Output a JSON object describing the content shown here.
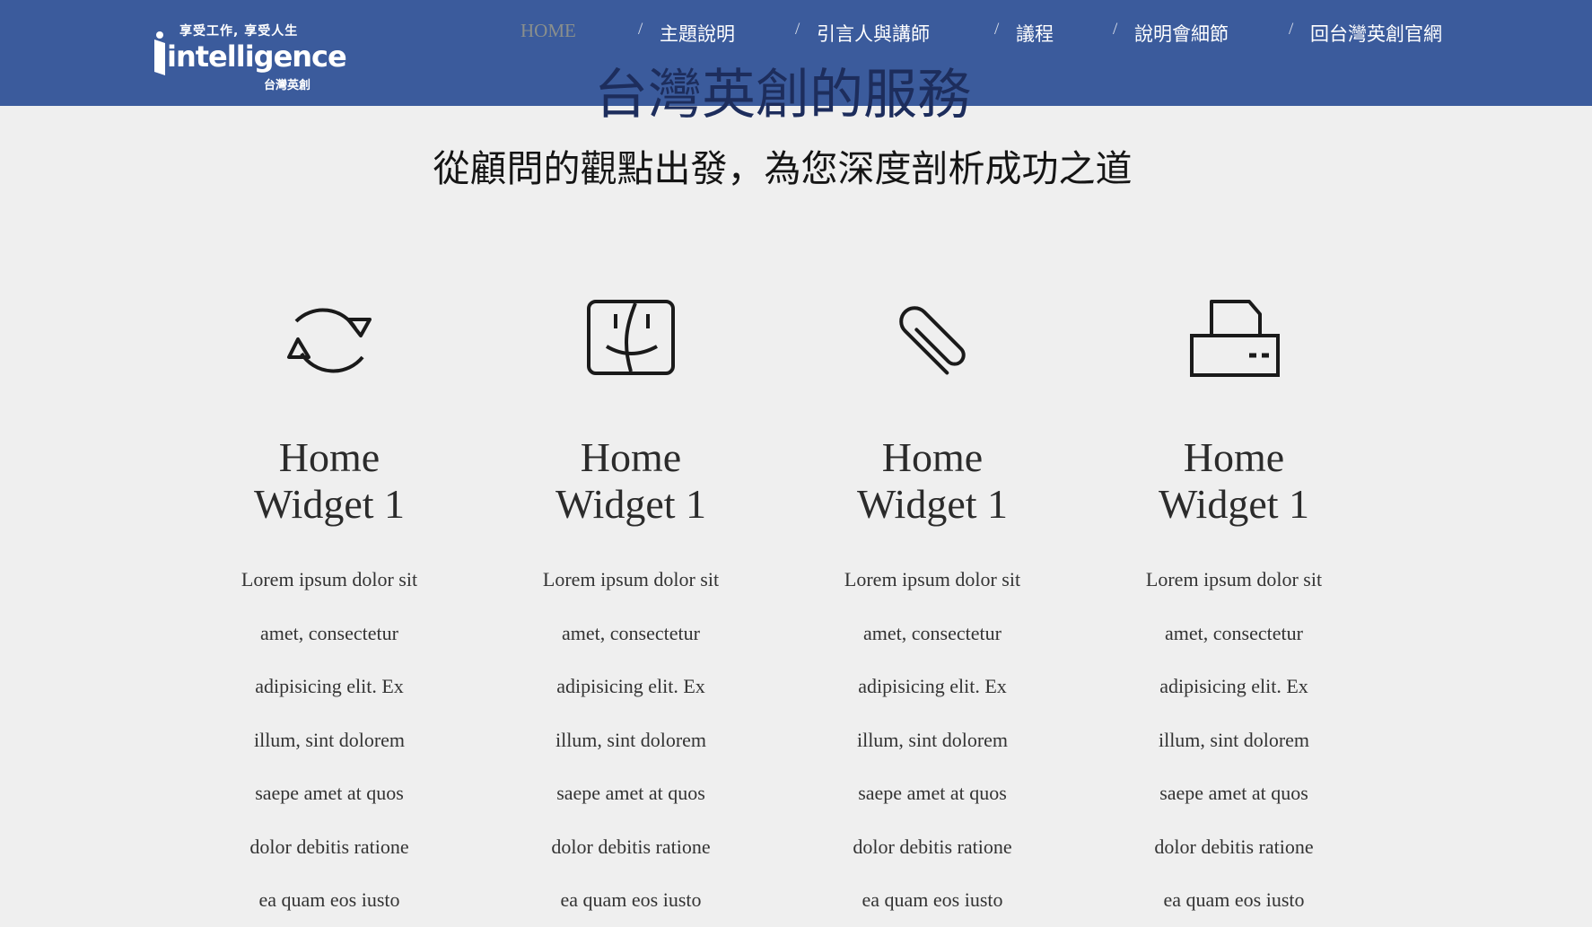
{
  "colors": {
    "navbar_bg": "#3b5b9c",
    "page_bg": "#efefef",
    "hero_title": "#1d2d5c",
    "nav_active": "#8a8f8c",
    "nav_text": "#ffffff"
  },
  "logo": {
    "tagline": "享受工作, 享受人生",
    "wordmark": "intelligence",
    "sub": "台灣英創"
  },
  "nav": {
    "items": [
      {
        "label": "HOME",
        "active": true
      },
      {
        "label": "主題說明",
        "active": false
      },
      {
        "label": "引言人與講師",
        "active": false
      },
      {
        "label": "議程",
        "active": false
      },
      {
        "label": "說明會細節",
        "active": false
      },
      {
        "label": "回台灣英創官網",
        "active": false
      }
    ],
    "separator": "/"
  },
  "hero": {
    "title": "台灣英創的服務",
    "subtitle": "從顧問的觀點出發，為您深度剖析成功之道"
  },
  "widgets": [
    {
      "icon": "sync-icon",
      "title_line1": "Home",
      "title_line2": "Widget 1",
      "lines": [
        "Lorem ipsum dolor sit",
        "amet, consectetur",
        "adipisicing elit. Ex",
        "illum, sint dolorem",
        "saepe amet at quos",
        "dolor debitis ratione",
        "ea quam eos iusto"
      ]
    },
    {
      "icon": "finder-face-icon",
      "title_line1": "Home",
      "title_line2": "Widget 1",
      "lines": [
        "Lorem ipsum dolor sit",
        "amet, consectetur",
        "adipisicing elit. Ex",
        "illum, sint dolorem",
        "saepe amet at quos",
        "dolor debitis ratione",
        "ea quam eos iusto"
      ]
    },
    {
      "icon": "paperclip-icon",
      "title_line1": "Home",
      "title_line2": "Widget 1",
      "lines": [
        "Lorem ipsum dolor sit",
        "amet, consectetur",
        "adipisicing elit. Ex",
        "illum, sint dolorem",
        "saepe amet at quos",
        "dolor debitis ratione",
        "ea quam eos iusto"
      ]
    },
    {
      "icon": "printer-icon",
      "title_line1": "Home",
      "title_line2": "Widget 1",
      "lines": [
        "Lorem ipsum dolor sit",
        "amet, consectetur",
        "adipisicing elit. Ex",
        "illum, sint dolorem",
        "saepe amet at quos",
        "dolor debitis ratione",
        "ea quam eos iusto"
      ]
    }
  ]
}
